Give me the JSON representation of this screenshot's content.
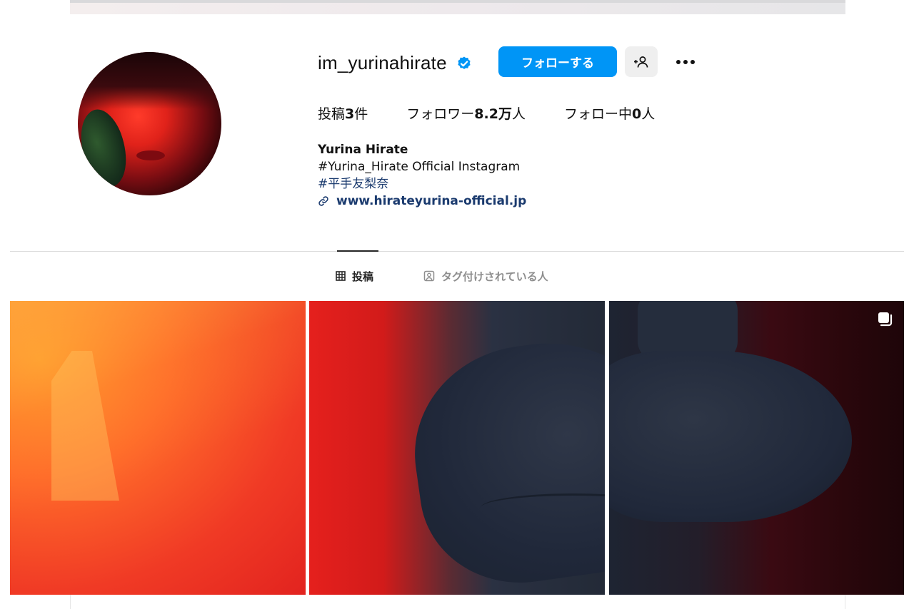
{
  "profile": {
    "username": "im_yurinahirate",
    "verified": true,
    "follow_label": "フォローする",
    "stats": {
      "posts_prefix": "投稿",
      "posts_count": "3",
      "posts_suffix": "件",
      "followers_prefix": "フォロワー",
      "followers_count": "8.2万",
      "followers_suffix": "人",
      "following_prefix": "フォロー中",
      "following_count": "0",
      "following_suffix": "人"
    },
    "bio": {
      "name": "Yurina Hirate",
      "line1": "#Yurina_Hirate Official Instagram",
      "hashtag": "#平手友梨奈",
      "link": "www.hirateyurina-official.jp"
    }
  },
  "tabs": [
    {
      "label": "投稿",
      "icon": "grid-icon",
      "active": true
    },
    {
      "label": "タグ付けされている人",
      "icon": "tagged-icon",
      "active": false
    }
  ],
  "posts": [
    {
      "id": "post-1",
      "multi": false
    },
    {
      "id": "post-2",
      "multi": false
    },
    {
      "id": "post-3",
      "multi": true
    }
  ],
  "colors": {
    "accent": "#0095f6",
    "link": "#1a3a6e",
    "verified": "#0095f6",
    "divider": "#dbdbdb"
  }
}
